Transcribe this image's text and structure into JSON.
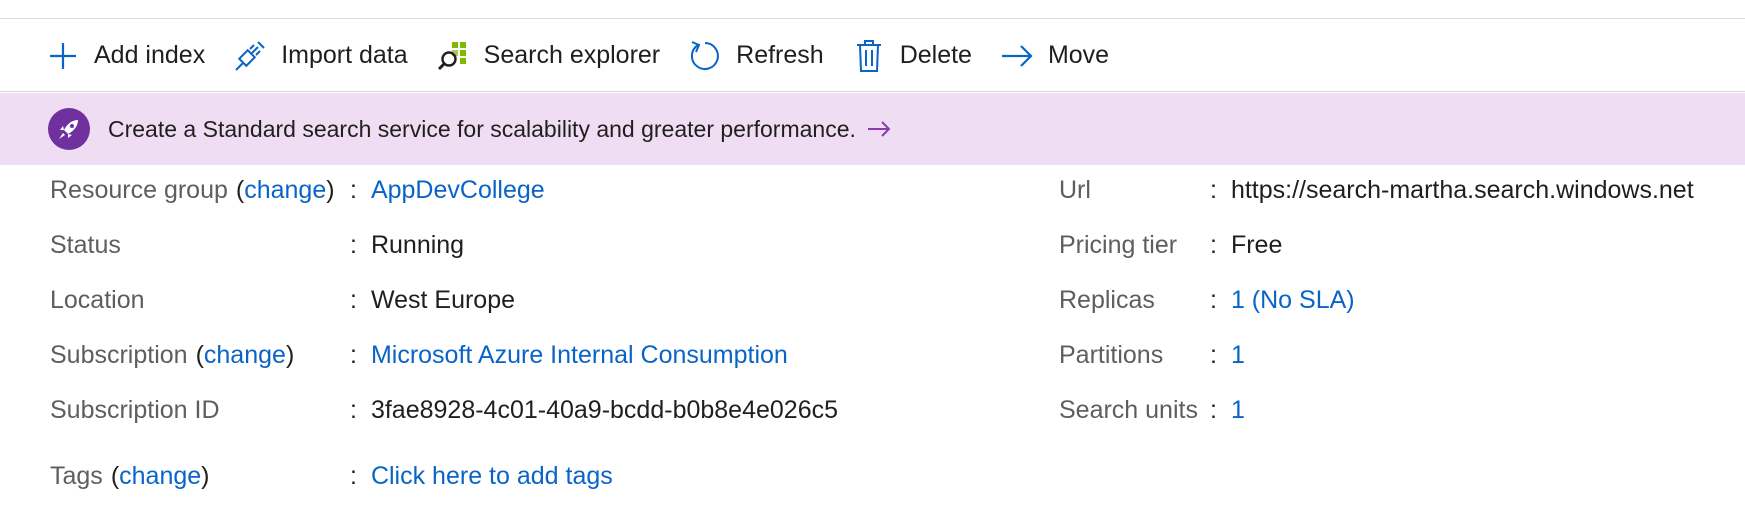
{
  "toolbar": {
    "add_index": "Add index",
    "import_data": "Import data",
    "search_explorer": "Search explorer",
    "refresh": "Refresh",
    "delete": "Delete",
    "move": "Move"
  },
  "banner": {
    "text": "Create a Standard search service for scalability and greater performance."
  },
  "essentials": {
    "separator": ":",
    "change_link": "change",
    "left": {
      "resource_group": {
        "label": "Resource group",
        "value": "AppDevCollege"
      },
      "status": {
        "label": "Status",
        "value": "Running"
      },
      "location": {
        "label": "Location",
        "value": "West Europe"
      },
      "subscription": {
        "label": "Subscription",
        "value": "Microsoft Azure Internal Consumption"
      },
      "subscription_id": {
        "label": "Subscription ID",
        "value": "3fae8928-4c01-40a9-bcdd-b0b8e4e026c5"
      },
      "tags": {
        "label": "Tags",
        "value": "Click here to add tags"
      }
    },
    "right": {
      "url": {
        "label": "Url",
        "value": "https://search-martha.search.windows.net"
      },
      "pricing_tier": {
        "label": "Pricing tier",
        "value": "Free"
      },
      "replicas": {
        "label": "Replicas",
        "value": "1 (No SLA)"
      },
      "partitions": {
        "label": "Partitions",
        "value": "1"
      },
      "search_units": {
        "label": "Search units",
        "value": "1"
      }
    }
  },
  "colors": {
    "link": "#0a64c8",
    "banner_bg": "#efddf3",
    "badge": "#7030a0",
    "label_gray": "#605e5c"
  },
  "icons": {
    "add_index": "plus-icon",
    "import_data": "plug-icon",
    "search_explorer": "search-explorer-icon",
    "refresh": "refresh-icon",
    "delete": "trash-icon",
    "move": "arrow-right-icon",
    "banner": "rocket-icon"
  }
}
